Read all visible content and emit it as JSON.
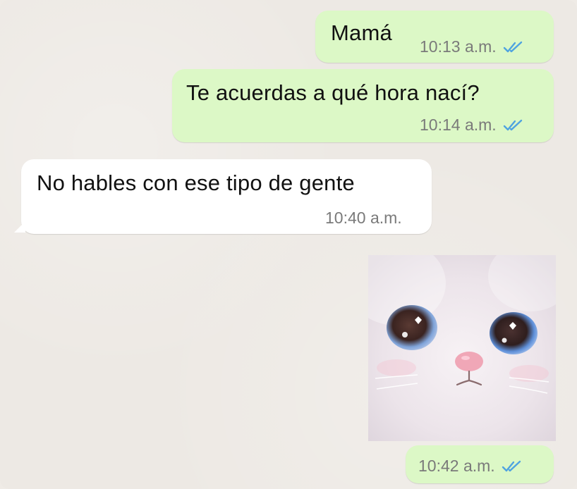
{
  "messages": [
    {
      "text": "Mamá",
      "time": "10:13 a.m.",
      "direction": "outgoing",
      "status": "read"
    },
    {
      "text": "Te acuerdas a qué hora nací?",
      "time": "10:14 a.m.",
      "direction": "outgoing",
      "status": "read"
    },
    {
      "text": "No hables con ese tipo de gente",
      "time": "10:40 a.m.",
      "direction": "incoming"
    },
    {
      "type": "image",
      "image": "sad-kitten-sticker",
      "time": "10:42 a.m.",
      "direction": "outgoing",
      "status": "read"
    }
  ],
  "colors": {
    "outgoing_bubble": "#dcf8c6",
    "incoming_bubble": "#ffffff",
    "chat_background": "#ede9e4",
    "read_ticks": "#4fa3e0"
  }
}
